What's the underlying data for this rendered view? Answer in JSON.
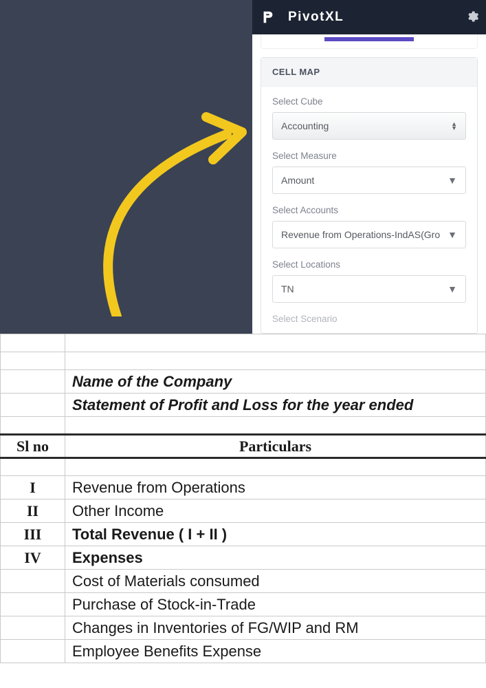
{
  "panel": {
    "app_title": "PivotXL",
    "card_title": "CELL MAP",
    "fields": {
      "cube": {
        "label": "Select Cube",
        "value": "Accounting"
      },
      "measure": {
        "label": "Select Measure",
        "value": "Amount"
      },
      "accounts": {
        "label": "Select Accounts",
        "value": "Revenue from Operations-IndAS(Gro"
      },
      "locations": {
        "label": "Select Locations",
        "value": "TN"
      },
      "scenario": {
        "label": "Select Scenario",
        "value": ""
      }
    }
  },
  "sheet": {
    "title1": "Name of the Company",
    "title2": "Statement of Profit and Loss for the year ended",
    "col_a_header": "Sl no",
    "col_b_header": "Particulars",
    "rows": [
      {
        "sl": "I",
        "p": "Revenue from Operations",
        "bold": false
      },
      {
        "sl": "II",
        "p": "Other Income",
        "bold": false
      },
      {
        "sl": "III",
        "p": "Total Revenue ( I + II )",
        "bold": true
      },
      {
        "sl": "IV",
        "p": "Expenses",
        "bold": true
      },
      {
        "sl": "",
        "p": "Cost of Materials consumed",
        "bold": false
      },
      {
        "sl": "",
        "p": "Purchase of Stock-in-Trade",
        "bold": false
      },
      {
        "sl": "",
        "p": "Changes in Inventories of FG/WIP and RM",
        "bold": false
      },
      {
        "sl": "",
        "p": "Employee Benefits Expense",
        "bold": false
      }
    ]
  }
}
